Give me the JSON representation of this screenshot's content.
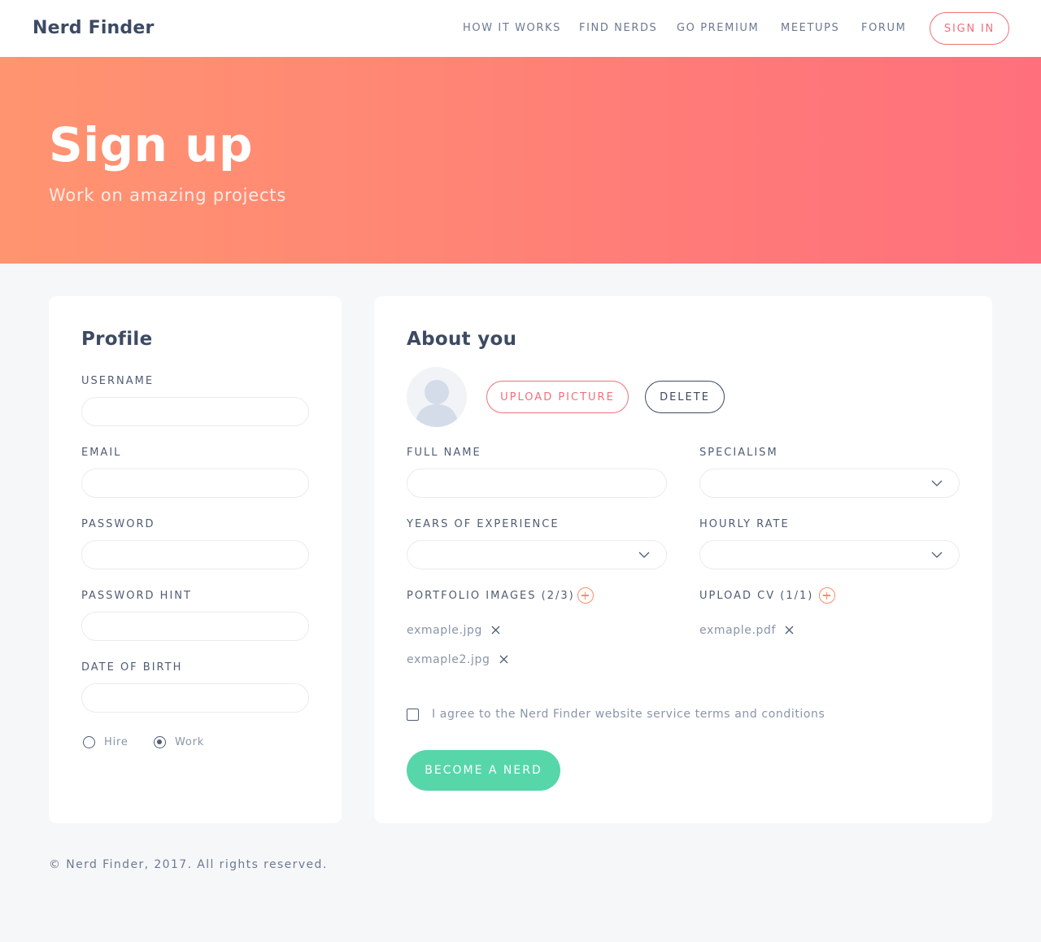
{
  "brand": "Nerd Finder",
  "nav": {
    "items": [
      "HOW IT WORKS",
      "FIND NERDS",
      "GO PREMIUM",
      "MEETUPS",
      "FORUM"
    ],
    "signin_label": "SIGN IN"
  },
  "hero": {
    "title": "Sign up",
    "subtitle": "Work on amazing projects"
  },
  "profile": {
    "heading": "Profile",
    "fields": {
      "username": {
        "label": "USERNAME",
        "value": ""
      },
      "email": {
        "label": "EMAIL",
        "value": ""
      },
      "password": {
        "label": "PASSWORD",
        "value": ""
      },
      "password_hint": {
        "label": "PASSWORD HINT",
        "value": ""
      },
      "date_of_birth": {
        "label": "DATE OF BIRTH",
        "value": ""
      }
    },
    "mode": {
      "options": [
        "Hire",
        "Work"
      ],
      "selected": "Work"
    }
  },
  "about": {
    "heading": "About you",
    "upload_picture_label": "UPLOAD PICTURE",
    "delete_label": "DELETE",
    "full_name_label": "FULL NAME",
    "specialism_label": "SPECIALISM",
    "years_label": "YEARS OF EXPERIENCE",
    "rate_label": "HOURLY RATE",
    "portfolio_label": "PORTFOLIO IMAGES (2/3)",
    "cv_label": "UPLOAD CV (1/1)",
    "portfolio_files": [
      "exmaple.jpg",
      "exmaple2.jpg"
    ],
    "cv_files": [
      "exmaple.pdf"
    ],
    "terms_label": "I agree to the Nerd Finder website service terms and conditions",
    "terms_checked": false,
    "submit_label": "BECOME A NERD"
  },
  "footer": "© Nerd Finder, 2017. All rights reserved.",
  "colors": {
    "accent_red": "#f0707a",
    "accent_orange": "#ff8a6b",
    "accent_green": "#57d6aa",
    "text_dark": "#3d4a63",
    "background": "#f6f7f9"
  },
  "icons": {
    "avatar": "user-silhouette-icon",
    "add": "plus-circle-icon",
    "remove": "close-icon",
    "dropdown": "chevron-down-icon"
  }
}
